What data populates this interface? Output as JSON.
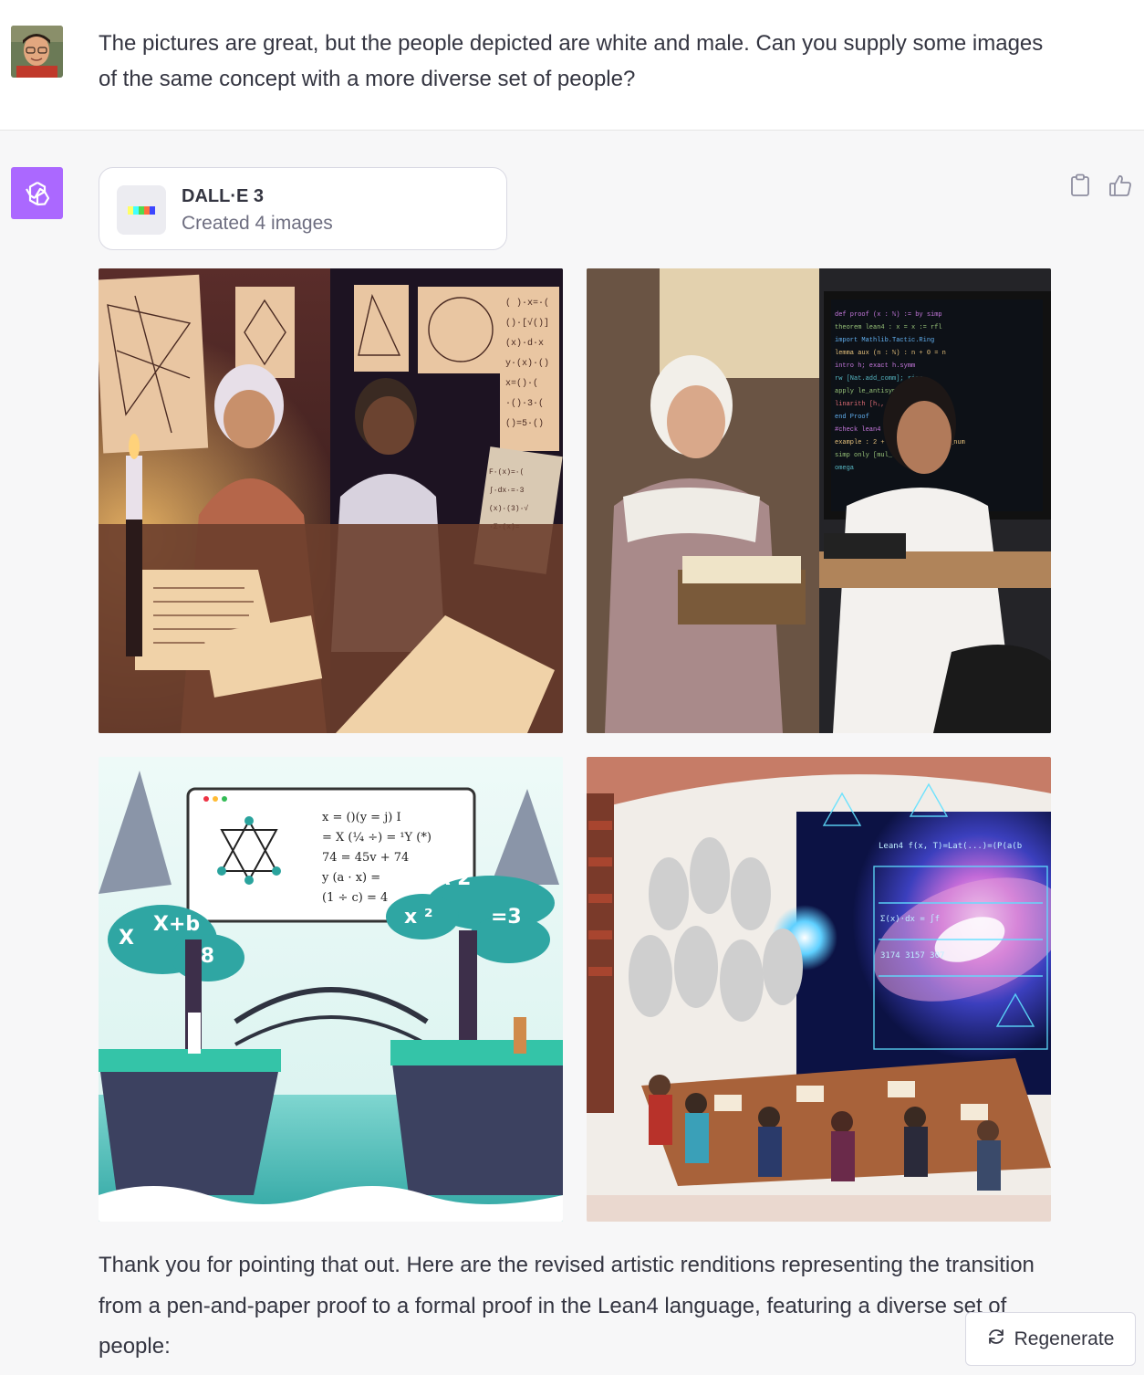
{
  "user_message": {
    "text": "The pictures are great, but the people depicted are white and male.  Can you supply some images of the same concept with a more diverse set of people?"
  },
  "assistant_message": {
    "tool": {
      "name": "DALL·E 3",
      "status": "Created 4 images"
    },
    "images": [
      {
        "id": "image-1"
      },
      {
        "id": "image-2"
      },
      {
        "id": "image-3"
      },
      {
        "id": "image-4"
      }
    ],
    "reply": "Thank you for pointing that out. Here are the revised artistic renditions representing the transition from a pen-and-paper proof to a formal proof in the Lean4 language, featuring a diverse set of people:"
  },
  "actions": {
    "copy_icon": "clipboard-icon",
    "like_icon": "thumbs-up-icon"
  },
  "regenerate": {
    "label": "Regenerate",
    "icon": "refresh-icon"
  },
  "colors": {
    "assistant_avatar": "#ab68ff",
    "user_background": "#ffffff",
    "assistant_background": "#f7f7f8",
    "text": "#343541"
  }
}
